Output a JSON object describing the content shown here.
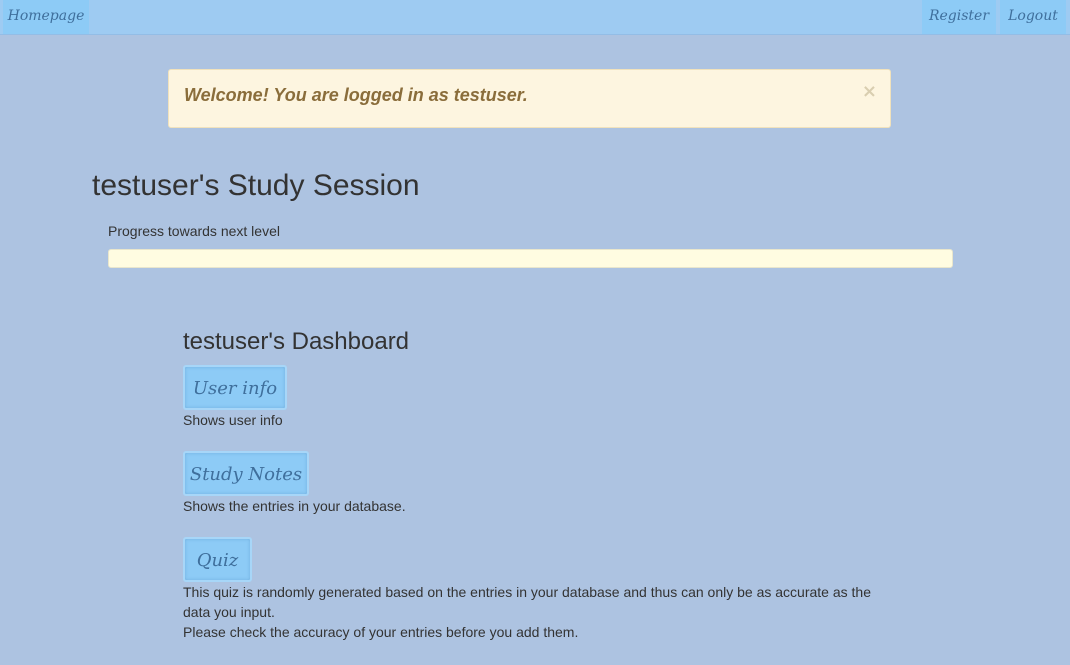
{
  "navbar": {
    "home_label": "Homepage",
    "register_label": "Register",
    "logout_label": "Logout"
  },
  "alert": {
    "message": "Welcome! You are logged in as testuser.",
    "close_glyph": "×"
  },
  "session": {
    "title": "testuser's Study Session",
    "progress_label": "Progress towards next level",
    "progress_fraction": 0.0
  },
  "dashboard": {
    "title": "testuser's Dashboard",
    "items": [
      {
        "button_label": "User info",
        "description": "Shows user info"
      },
      {
        "button_label": "Study Notes",
        "description": "Shows the entries in your database."
      },
      {
        "button_label": "Quiz",
        "description_lines": [
          "This quiz is randomly generated based on the entries in your database and thus can only be as accurate as the",
          "data you input.",
          "Please check the accuracy of your entries before you add them."
        ]
      }
    ]
  },
  "colors": {
    "background": "#adc3e1",
    "navbar": "#9ecbf2",
    "button": "#8dcbf6",
    "alert_bg": "#fdf5e0",
    "alert_text": "#8a6d3b",
    "progress_track": "#fffce1"
  }
}
